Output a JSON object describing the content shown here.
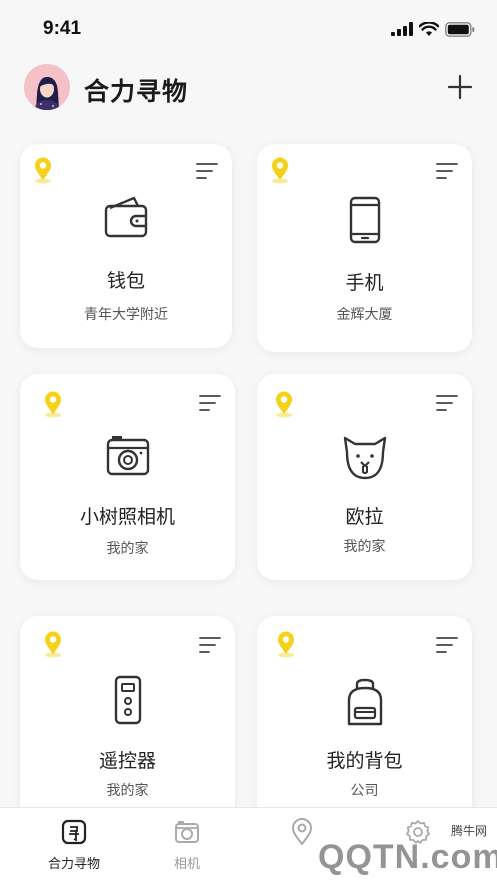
{
  "status": {
    "time": "9:41"
  },
  "header": {
    "title": "合力寻物"
  },
  "items": [
    {
      "name": "钱包",
      "location": "青年大学附近",
      "icon": "wallet-icon"
    },
    {
      "name": "手机",
      "location": "金辉大厦",
      "icon": "phone-icon"
    },
    {
      "name": "小树照相机",
      "location": "我的家",
      "icon": "camera-icon"
    },
    {
      "name": "欧拉",
      "location": "我的家",
      "icon": "pet-icon"
    },
    {
      "name": "遥控器",
      "location": "我的家",
      "icon": "remote-icon"
    },
    {
      "name": "我的背包",
      "location": "公司",
      "icon": "backpack-icon"
    }
  ],
  "tabs": [
    {
      "label": "合力寻物",
      "icon": "find-icon"
    },
    {
      "label": "相机",
      "icon": "camera-tab-icon"
    },
    {
      "label": "",
      "icon": "map-pin-tab-icon"
    },
    {
      "label": "",
      "icon": "settings-icon"
    }
  ],
  "colors": {
    "accent": "#f5d21a",
    "background": "#f7f7f7",
    "card": "#ffffff"
  },
  "watermark": {
    "small": "腾牛网",
    "big": "QQTN.com"
  }
}
